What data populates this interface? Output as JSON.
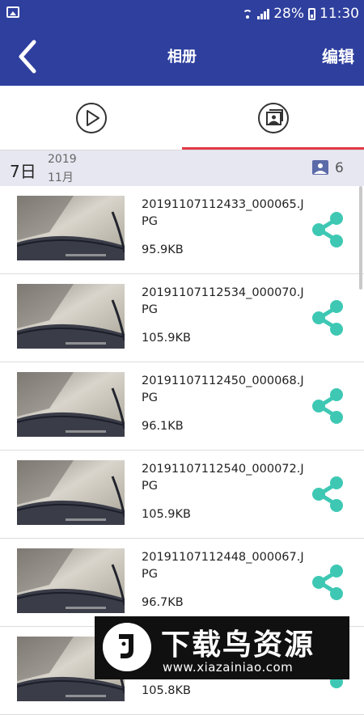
{
  "status_bar": {
    "battery": "28%",
    "time": "11:30",
    "icons": [
      "image-icon",
      "wifi-icon",
      "signal-icon",
      "battery-icon"
    ]
  },
  "header": {
    "title": "相册",
    "edit_label": "编辑",
    "background": "#2e3f9e"
  },
  "tabs": {
    "items": [
      {
        "name": "video",
        "icon": "play-icon",
        "active": false
      },
      {
        "name": "photo",
        "icon": "photo-album-icon",
        "active": true
      }
    ],
    "active_color": "#e03a45"
  },
  "date_group": {
    "day": "7日",
    "year": "2019",
    "month": "11月",
    "count": "6"
  },
  "files": [
    {
      "name": "20191107112433_000065.JPG",
      "size": "95.9KB"
    },
    {
      "name": "20191107112534_000070.JPG",
      "size": "105.9KB"
    },
    {
      "name": "20191107112450_000068.JPG",
      "size": "96.1KB"
    },
    {
      "name": "20191107112540_000072.JPG",
      "size": "105.9KB"
    },
    {
      "name": "20191107112448_000067.JPG",
      "size": "96.7KB"
    },
    {
      "name": "",
      "size": "105.8KB"
    }
  ],
  "share_color": "#3ec8b4",
  "watermark": {
    "title": "下载鸟资源",
    "url": "www.xiazainiao.com"
  }
}
